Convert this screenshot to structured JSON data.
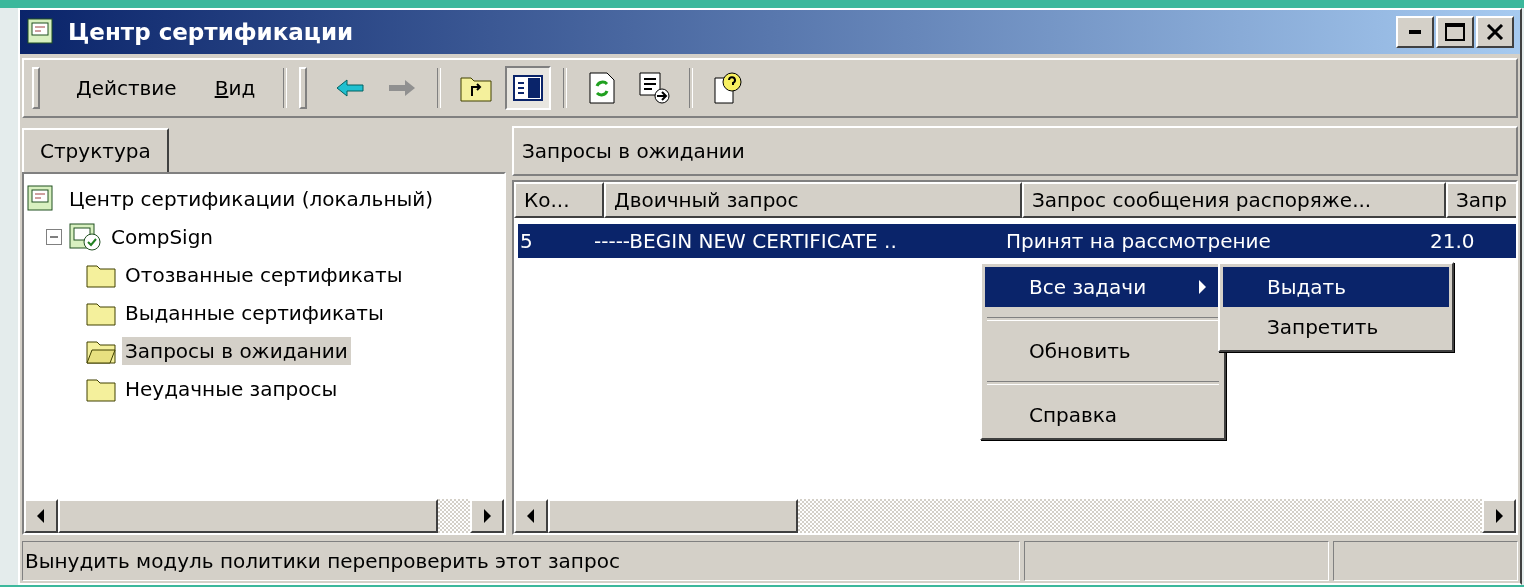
{
  "window": {
    "title": "Центр сертификации"
  },
  "menu_bar": [
    {
      "label": "Действие"
    },
    {
      "label": "Вид"
    }
  ],
  "toolbar": [
    {
      "kind": "back",
      "pressed": false
    },
    {
      "kind": "forward",
      "disabled": true,
      "pressed": false
    },
    {
      "kind": "separator"
    },
    {
      "kind": "up",
      "pressed": false
    },
    {
      "kind": "tree",
      "pressed": true
    },
    {
      "kind": "separator"
    },
    {
      "kind": "refresh",
      "pressed": false
    },
    {
      "kind": "export",
      "pressed": false
    },
    {
      "kind": "separator"
    },
    {
      "kind": "help",
      "pressed": false
    }
  ],
  "left_tabs": [
    {
      "label": "Структура",
      "selected": true
    }
  ],
  "tree": [
    {
      "label": "Центр сертификации (локальный)",
      "kind": "root",
      "selected": false,
      "children": [
        {
          "label": "CompSign",
          "kind": "ca",
          "selected": false,
          "expanded": true,
          "children": [
            {
              "label": "Отозванные сертификаты",
              "kind": "folder",
              "selected": false
            },
            {
              "label": "Выданные сертификаты",
              "kind": "folder",
              "selected": false
            },
            {
              "label": "Запросы в ожидании",
              "kind": "open-folder",
              "selected": true
            },
            {
              "label": "Неудачные запросы",
              "kind": "folder",
              "selected": false
            }
          ]
        }
      ]
    }
  ],
  "right_header": "Запросы в ожидании",
  "table": {
    "columns": [
      "Ко...",
      "Двоичный запрос",
      "Запрос сообщения распоряже...",
      "Запр"
    ],
    "rows": [
      {
        "selected": true,
        "cells": [
          "5",
          "-----BEGIN NEW CERTIFICATE ..",
          "Принят на рассмотрение",
          "21.0"
        ]
      }
    ]
  },
  "context_menu": [
    {
      "kind": "item",
      "label": "Все задачи",
      "selected": true,
      "has_submenu": true
    },
    {
      "kind": "separator"
    },
    {
      "kind": "item",
      "label": "Обновить",
      "selected": false,
      "has_submenu": false
    },
    {
      "kind": "separator"
    },
    {
      "kind": "item",
      "label": "Справка",
      "selected": false,
      "has_submenu": false
    }
  ],
  "submenu": [
    {
      "label": "Выдать",
      "selected": true
    },
    {
      "label": "Запретить",
      "selected": false
    }
  ],
  "status_bar": {
    "text": "Вынудить модуль политики перепроверить этот запрос"
  }
}
